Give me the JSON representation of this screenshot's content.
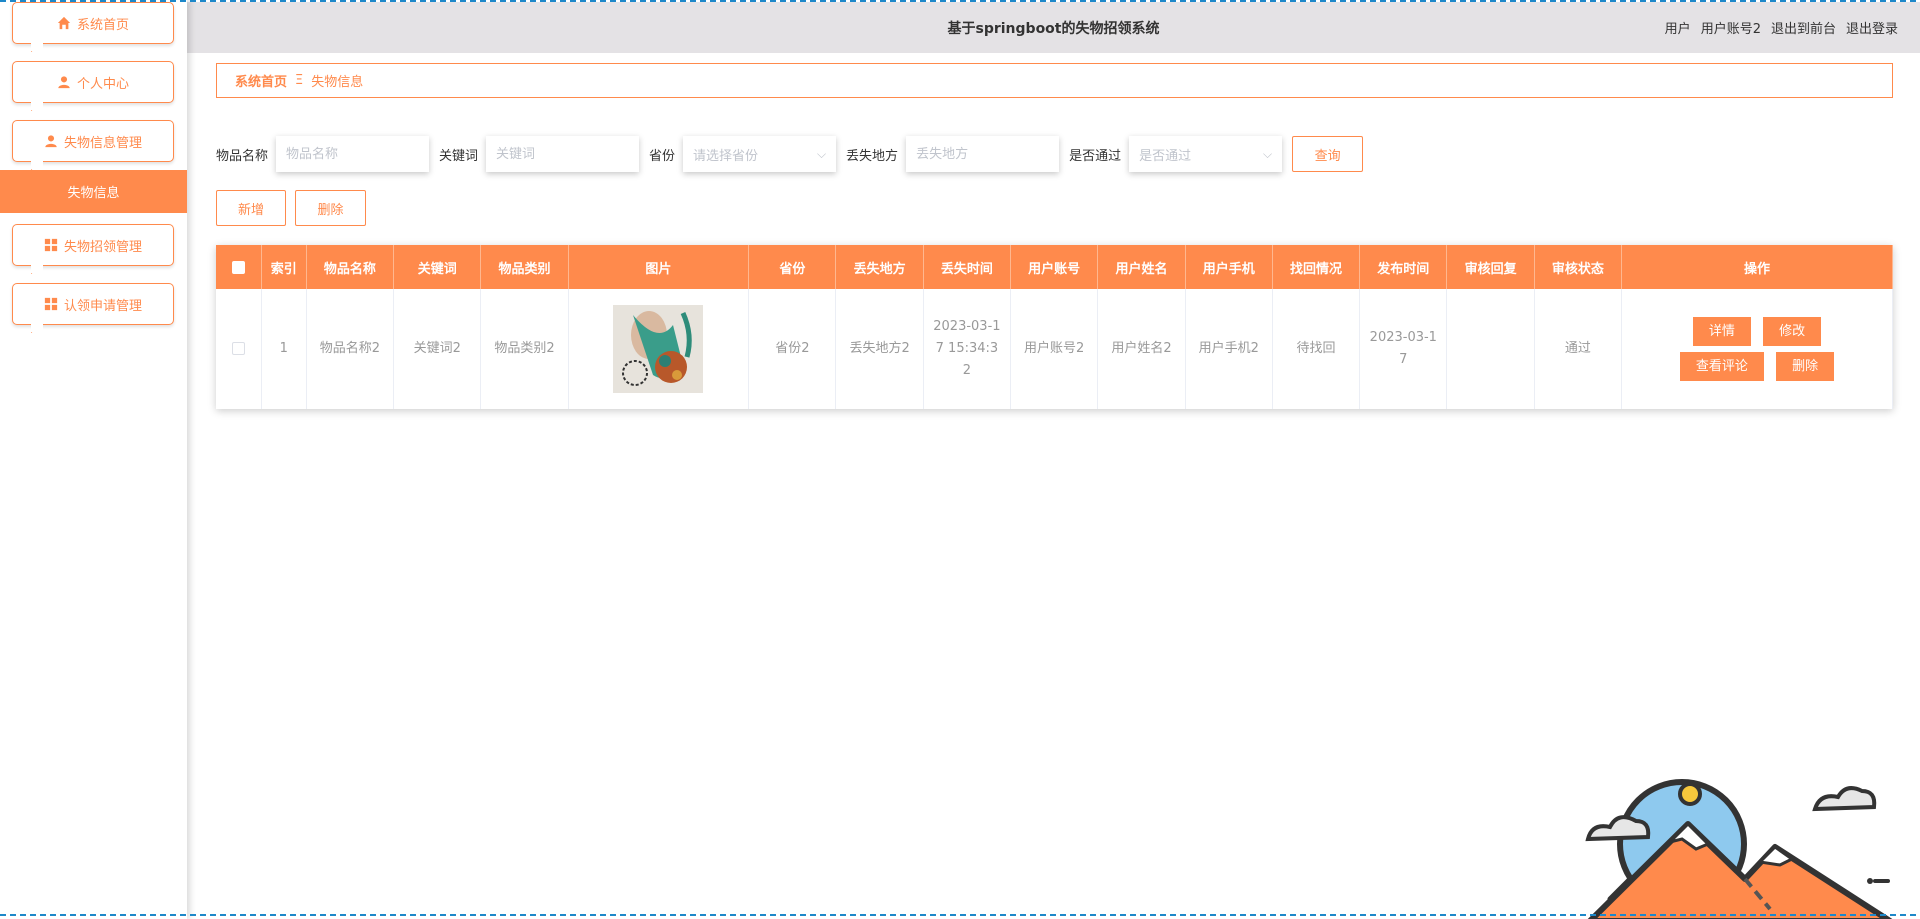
{
  "sidebar": {
    "items": [
      {
        "label": "系统首页",
        "icon": "home-icon"
      },
      {
        "label": "个人中心",
        "icon": "user-icon"
      },
      {
        "label": "失物信息管理",
        "icon": "user-icon"
      },
      {
        "label": "失物招领管理",
        "icon": "grid-icon"
      },
      {
        "label": "认领申请管理",
        "icon": "grid-icon"
      }
    ],
    "active_sub": "失物信息"
  },
  "header": {
    "title": "基于springboot的失物招领系统",
    "role": "用户",
    "account": "用户账号2",
    "front_link": "退出到前台",
    "logout_link": "退出登录"
  },
  "breadcrumb": {
    "home": "系统首页",
    "separator": "Ξ",
    "current": "失物信息"
  },
  "search": {
    "name_label": "物品名称",
    "name_placeholder": "物品名称",
    "keyword_label": "关键词",
    "keyword_placeholder": "关键词",
    "province_label": "省份",
    "province_placeholder": "请选择省份",
    "place_label": "丢失地方",
    "place_placeholder": "丢失地方",
    "pass_label": "是否通过",
    "pass_placeholder": "是否通过",
    "query_button": "查询"
  },
  "actions": {
    "add": "新增",
    "delete": "删除"
  },
  "table": {
    "headers": [
      "索引",
      "物品名称",
      "关键词",
      "物品类别",
      "图片",
      "省份",
      "丢失地方",
      "丢失时间",
      "用户账号",
      "用户姓名",
      "用户手机",
      "找回情况",
      "发布时间",
      "审核回复",
      "审核状态",
      "操作"
    ],
    "rows": [
      {
        "index": "1",
        "name": "物品名称2",
        "keyword": "关键词2",
        "category": "物品类别2",
        "province": "省份2",
        "place": "丢失地方2",
        "lost_time": "2023-03-17 15:34:32",
        "account": "用户账号2",
        "user_name": "用户姓名2",
        "phone": "用户手机2",
        "found": "待找回",
        "publish_time": "2023-03-17",
        "reply": "",
        "status": "通过",
        "ops": {
          "detail": "详情",
          "edit": "修改",
          "comments": "查看评论",
          "delete": "删除"
        }
      }
    ]
  },
  "colors": {
    "accent": "#ff8a4c",
    "header_bg": "#e4e2e5"
  }
}
